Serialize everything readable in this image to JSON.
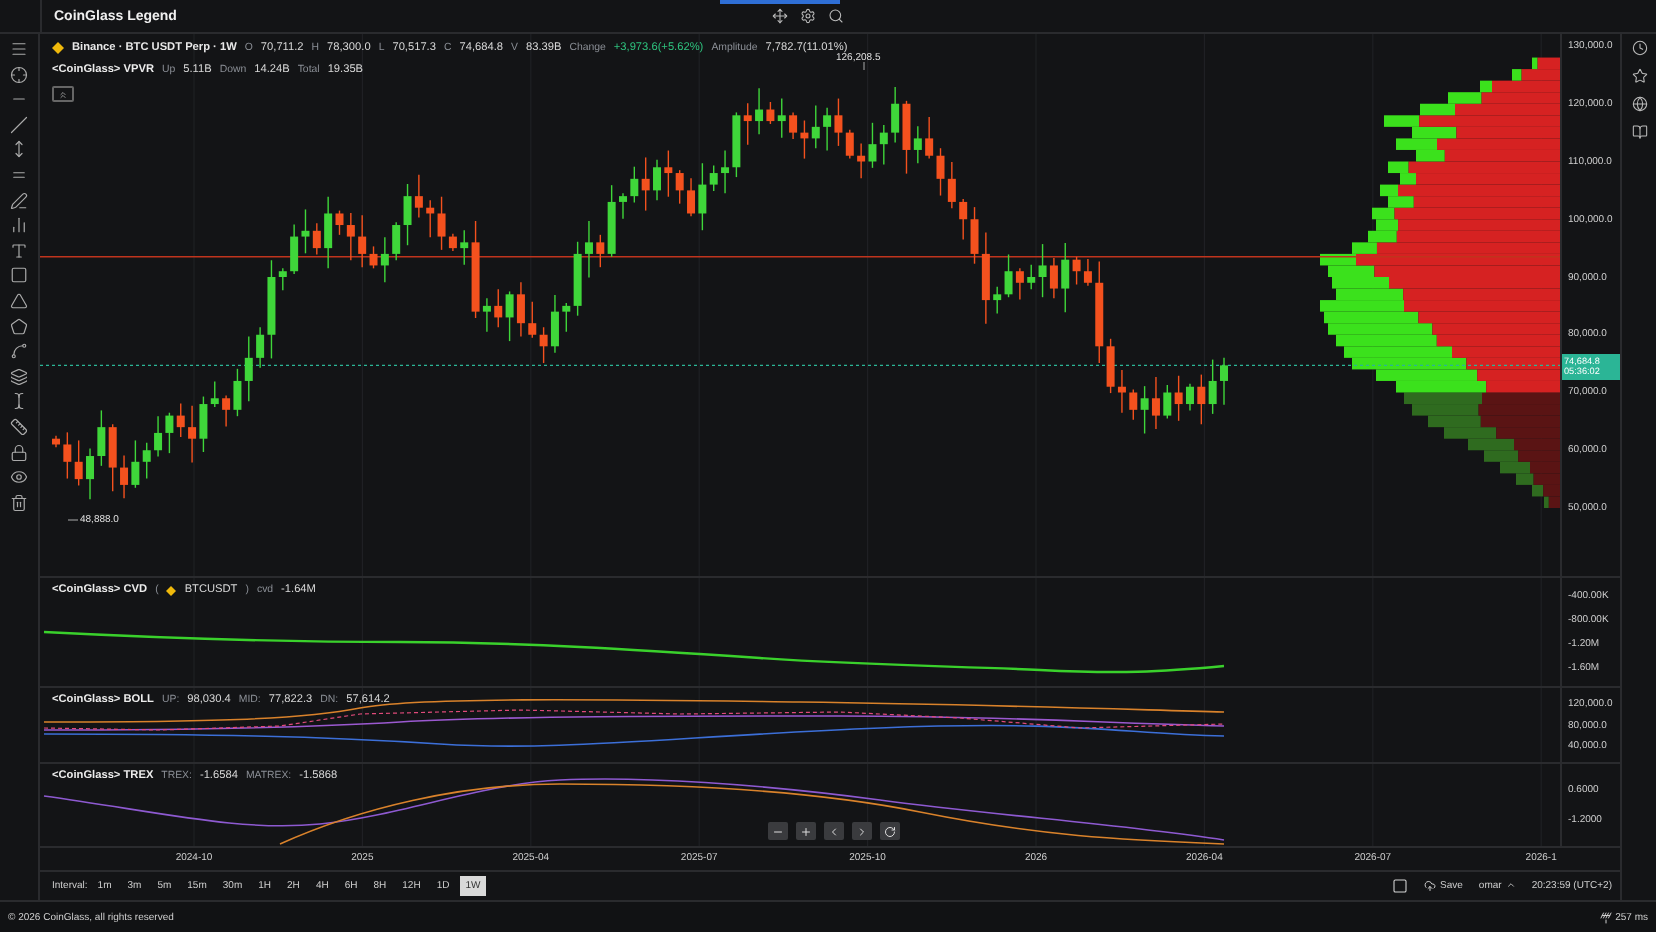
{
  "header": {
    "title": "CoinGlass Legend"
  },
  "legend": {
    "symbol": "Binance · BTC USDT Perp · 1W",
    "fields": [
      {
        "label": "O",
        "value": "70,711.2",
        "kind": "plain"
      },
      {
        "label": "H",
        "value": "78,300.0",
        "kind": "plain"
      },
      {
        "label": "L",
        "value": "70,517.3",
        "kind": "plain"
      },
      {
        "label": "C",
        "value": "74,684.8",
        "kind": "plain"
      },
      {
        "label": "V",
        "value": "83.39B",
        "kind": "plain"
      },
      {
        "label": "Change",
        "value": "+3,973.6(+5.62%)",
        "kind": "up"
      },
      {
        "label": "Amplitude",
        "value": "7,782.7(11.01%)",
        "kind": "plain"
      }
    ]
  },
  "vpvr": {
    "title": "<CoinGlass> VPVR",
    "fields": [
      {
        "label": "Up",
        "value": "5.11B"
      },
      {
        "label": "Down",
        "value": "14.24B"
      },
      {
        "label": "Total",
        "value": "19.35B"
      }
    ]
  },
  "price_axis": {
    "ticks": [
      "130,000.0",
      "120,000.0",
      "110,000.0",
      "100,000.0",
      "90,000.0",
      "80,000.0",
      "70,000.0",
      "60,000.0",
      "50,000.0"
    ]
  },
  "current_price": {
    "price": "74,684.8",
    "countdown": "05:36:02"
  },
  "high_label": "126,208.5",
  "low_label": "48,888.0",
  "panes": [
    {
      "kind": "cvd",
      "title": "<CoinGlass> CVD",
      "paren_open": "(",
      "symbol": "BTCUSDT",
      "paren_close": ")",
      "fields": [
        {
          "label": "cvd",
          "value": "-1.64M"
        }
      ],
      "ticks": [
        "-400.00K",
        "-800.00K",
        "-1.20M",
        "-1.60M"
      ]
    },
    {
      "kind": "boll",
      "title": "<CoinGlass> BOLL",
      "fields": [
        {
          "label": "UP:",
          "value": "98,030.4"
        },
        {
          "label": "MID:",
          "value": "77,822.3"
        },
        {
          "label": "DN:",
          "value": "57,614.2"
        }
      ],
      "ticks": [
        "120,000.0",
        "80,000.0",
        "40,000.0"
      ]
    },
    {
      "kind": "trex",
      "title": "<CoinGlass> TREX",
      "fields": [
        {
          "label": "TREX:",
          "value": "-1.6584"
        },
        {
          "label": "MATREX:",
          "value": "-1.5868"
        }
      ],
      "ticks": [
        "0.6000",
        "-1.2000"
      ]
    }
  ],
  "time_axis": [
    "2024-10",
    "2025",
    "2025-04",
    "2025-07",
    "2025-10",
    "2026",
    "2026-04",
    "2026-07",
    "2026-1"
  ],
  "interval": {
    "label": "Interval:",
    "options": [
      {
        "label": "1m",
        "selected": false
      },
      {
        "label": "3m",
        "selected": false
      },
      {
        "label": "5m",
        "selected": false
      },
      {
        "label": "15m",
        "selected": false
      },
      {
        "label": "30m",
        "selected": false
      },
      {
        "label": "1H",
        "selected": false
      },
      {
        "label": "2H",
        "selected": false
      },
      {
        "label": "4H",
        "selected": false
      },
      {
        "label": "6H",
        "selected": false
      },
      {
        "label": "8H",
        "selected": false
      },
      {
        "label": "12H",
        "selected": false
      },
      {
        "label": "1D",
        "selected": false
      },
      {
        "label": "1W",
        "selected": true
      }
    ]
  },
  "save": "Save",
  "user": "omar",
  "clock": "20:23:59 (UTC+2)",
  "footer": {
    "copyright": "© 2026 CoinGlass, all rights reserved",
    "latency": "257 ms"
  }
}
